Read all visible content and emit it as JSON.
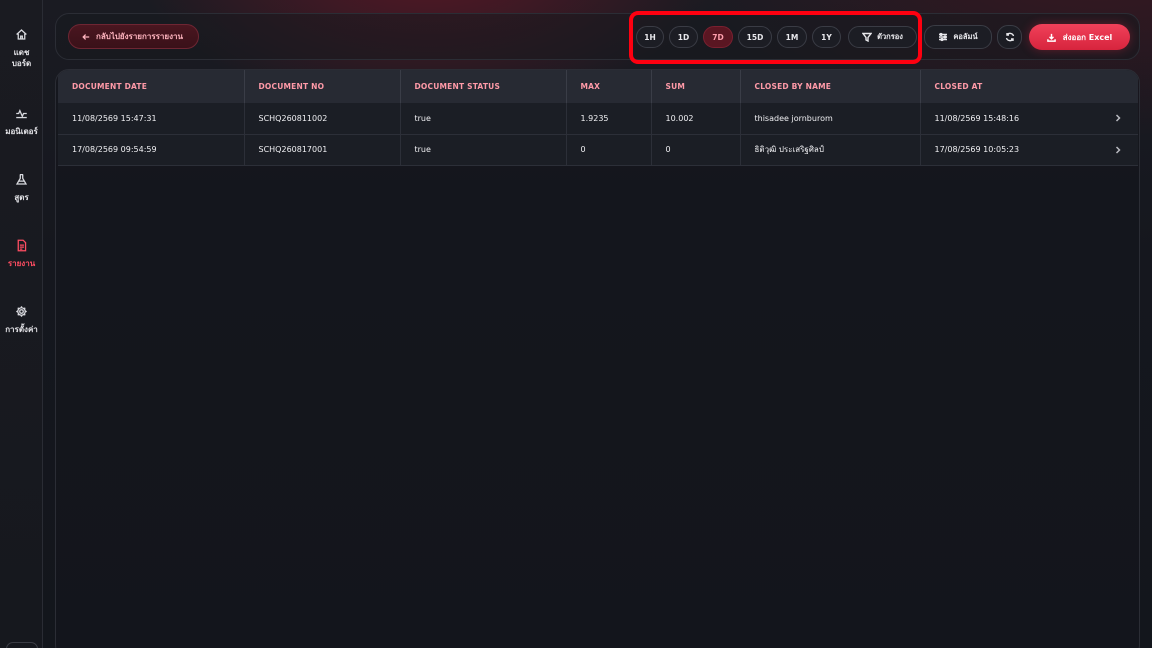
{
  "sidebar": {
    "items": [
      {
        "label": "แดช\nบอร์ด",
        "icon": "home-icon",
        "active": false
      },
      {
        "label": "มอนิเตอร์",
        "icon": "monitor-wave-icon",
        "active": false
      },
      {
        "label": "สูตร",
        "icon": "flask-icon",
        "active": false
      },
      {
        "label": "รายงาน",
        "icon": "document-icon",
        "active": true
      },
      {
        "label": "การตั้งค่า",
        "icon": "gear-icon",
        "active": false
      }
    ]
  },
  "toolbar": {
    "back_label": "กลับไปยังรายการรายงาน",
    "ranges": [
      {
        "label": "1H",
        "active": false
      },
      {
        "label": "1D",
        "active": false
      },
      {
        "label": "7D",
        "active": true
      },
      {
        "label": "15D",
        "active": false
      },
      {
        "label": "1M",
        "active": false
      },
      {
        "label": "1Y",
        "active": false
      }
    ],
    "filter_label": "ตัวกรอง",
    "columns_label": "คอลัมน์",
    "export_label": "ส่งออก Excel"
  },
  "table": {
    "headers": [
      "DOCUMENT DATE",
      "DOCUMENT NO",
      "DOCUMENT STATUS",
      "MAX",
      "SUM",
      "CLOSED BY NAME",
      "CLOSED AT"
    ],
    "rows": [
      [
        "11/08/2569 15:47:31",
        "SCHQ260811002",
        "true",
        "1.9235",
        "10.002",
        "thisadee jornburom",
        "11/08/2569 15:48:16"
      ],
      [
        "17/08/2569 09:54:59",
        "SCHQ260817001",
        "true",
        "0",
        "0",
        "ธิติวุฒิ ประเสริฐศิลป์",
        "17/08/2569 10:05:23"
      ]
    ]
  },
  "colors": {
    "accent": "#e8304a",
    "highlight": "#ff0010",
    "header_text": "#ff9aa8"
  }
}
